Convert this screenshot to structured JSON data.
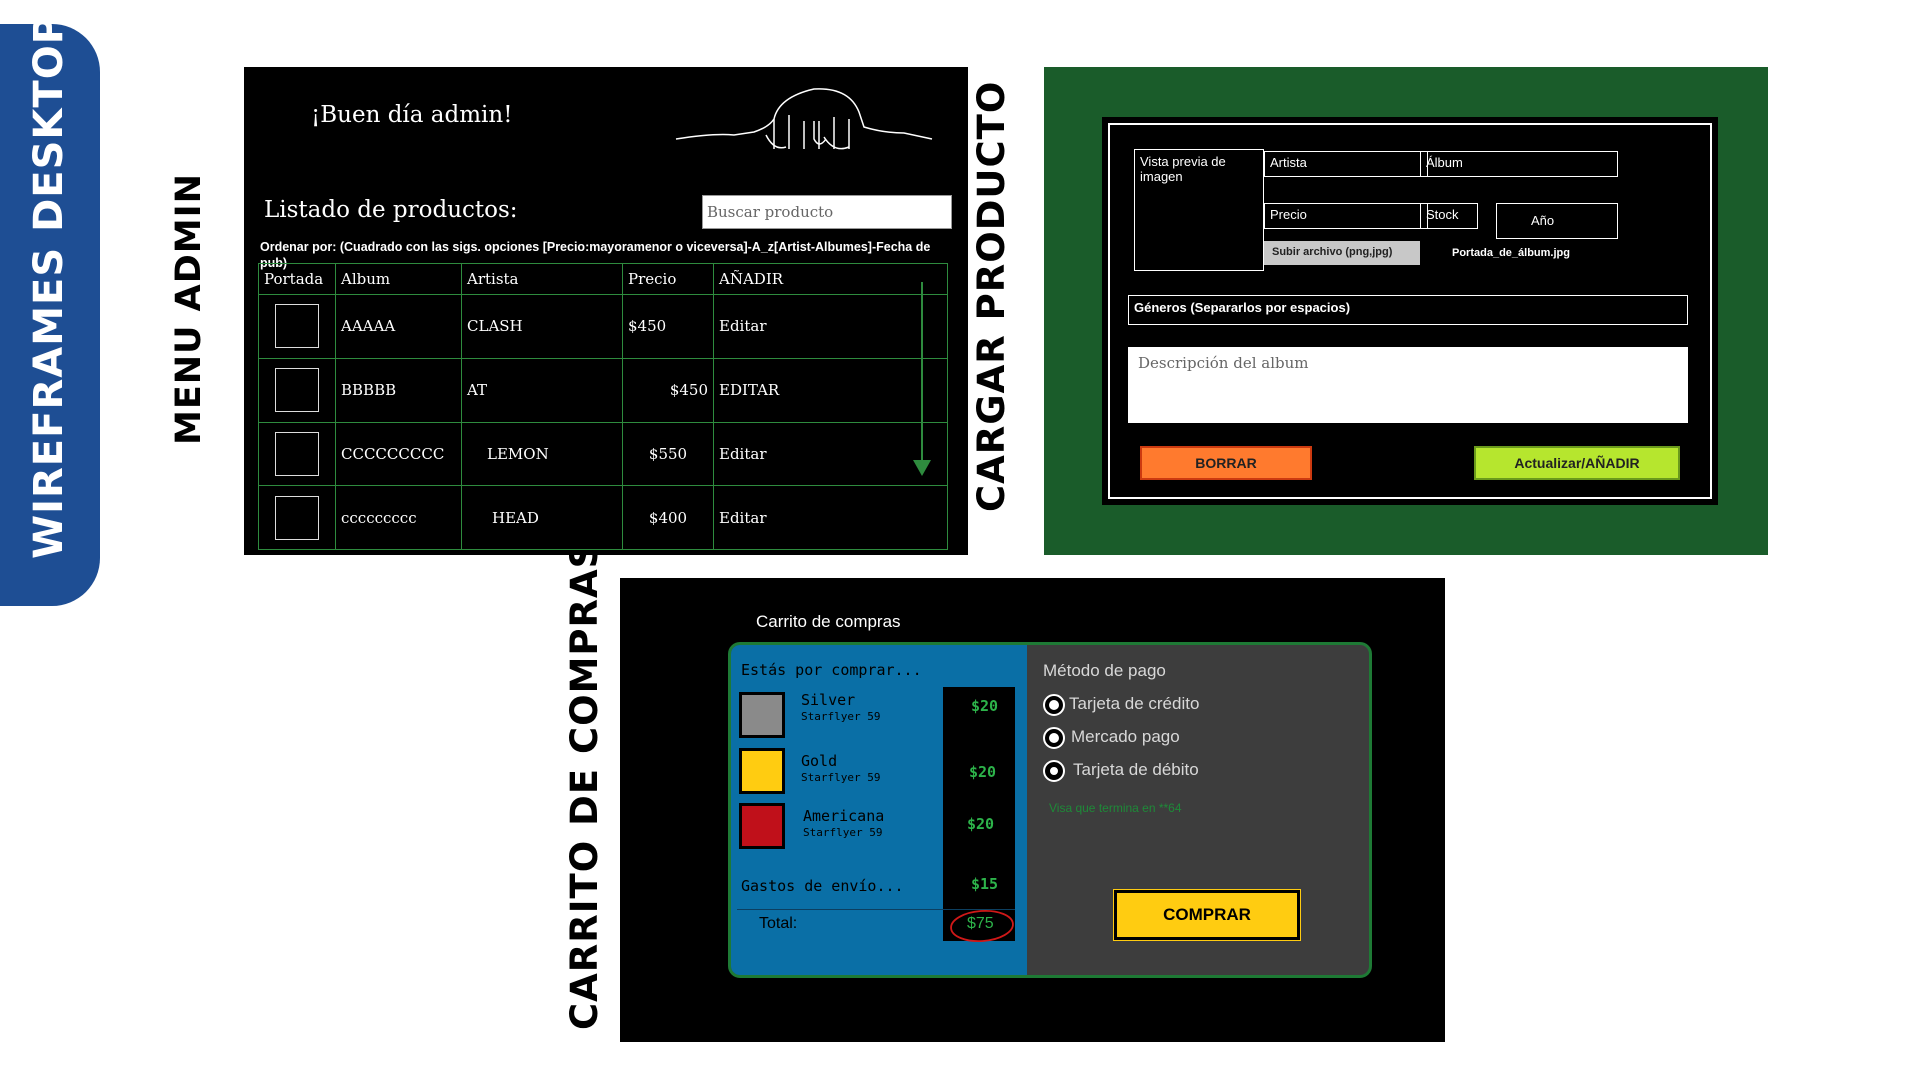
{
  "side_tab": {
    "label": "WIREFRAMES DESKTOP"
  },
  "labels": {
    "menu_admin": "MENU ADMIN",
    "cargar_producto": "CARGAR PRODUCTO",
    "carrito_compras": "CARRITO DE COMPRAS"
  },
  "admin": {
    "greeting": "¡Buen día admin!",
    "list_title": "Listado de productos:",
    "search_placeholder": "Buscar producto",
    "order_text": "Ordenar por: (Cuadrado con las sigs. opciones [Precio:mayoramenor o viceversa]-A_z[Artist-Albumes]-Fecha de pub)",
    "columns": [
      "Portada",
      "Album",
      "Artista",
      "Precio",
      "AÑADIR"
    ],
    "rows": [
      {
        "album": "AAAAA",
        "artista": "CLASH",
        "precio": "$450",
        "accion": "Editar"
      },
      {
        "album": "BBBBB",
        "artista": "AT",
        "precio": "$450",
        "accion": "EDITAR"
      },
      {
        "album": "CCCCCCCCC",
        "artista": "LEMON",
        "precio": "$550",
        "accion": "Editar"
      },
      {
        "album": "ccccccccc",
        "artista": "HEAD",
        "precio": "$400",
        "accion": "Editar"
      }
    ]
  },
  "cargar": {
    "preview": "Vista previa de imagen",
    "artista": "Artista",
    "album": "Álbum",
    "precio": "Precio",
    "stock": "Stock",
    "anio": "Año",
    "upload": "Subir archivo (png,jpg)",
    "filename": "Portada_de_álbum.jpg",
    "generos": "Géneros (Separarlos por espacios)",
    "descripcion": "Descripción del album",
    "borrar": "BORRAR",
    "actualizar": "Actualizar/AÑADIR",
    "colors": {
      "borrar": "#ff7a2e",
      "actualizar": "#b6e62e",
      "background": "#1a5c2a"
    }
  },
  "carrito": {
    "title": "Carrito de compras",
    "heading": "Estás por comprar...",
    "items": [
      {
        "name": "Silver",
        "sub": "Starflyer 59",
        "price": "$20",
        "color": "#8a8a8a"
      },
      {
        "name": "Gold",
        "sub": "Starflyer 59",
        "price": "$20",
        "color": "#ffcc11"
      },
      {
        "name": "Americana",
        "sub": "Starflyer 59",
        "price": "$20",
        "color": "#c0101a"
      }
    ],
    "shipping_label": "Gastos de envío...",
    "shipping_price": "$15",
    "total_label": "Total:",
    "total": "$75",
    "payment_title": "Método de pago",
    "payment_options": [
      "Tarjeta de crédito",
      "Mercado pago",
      "Tarjeta de débito"
    ],
    "card_note": "Visa que termina en **64",
    "buy": "COMPRAR"
  }
}
